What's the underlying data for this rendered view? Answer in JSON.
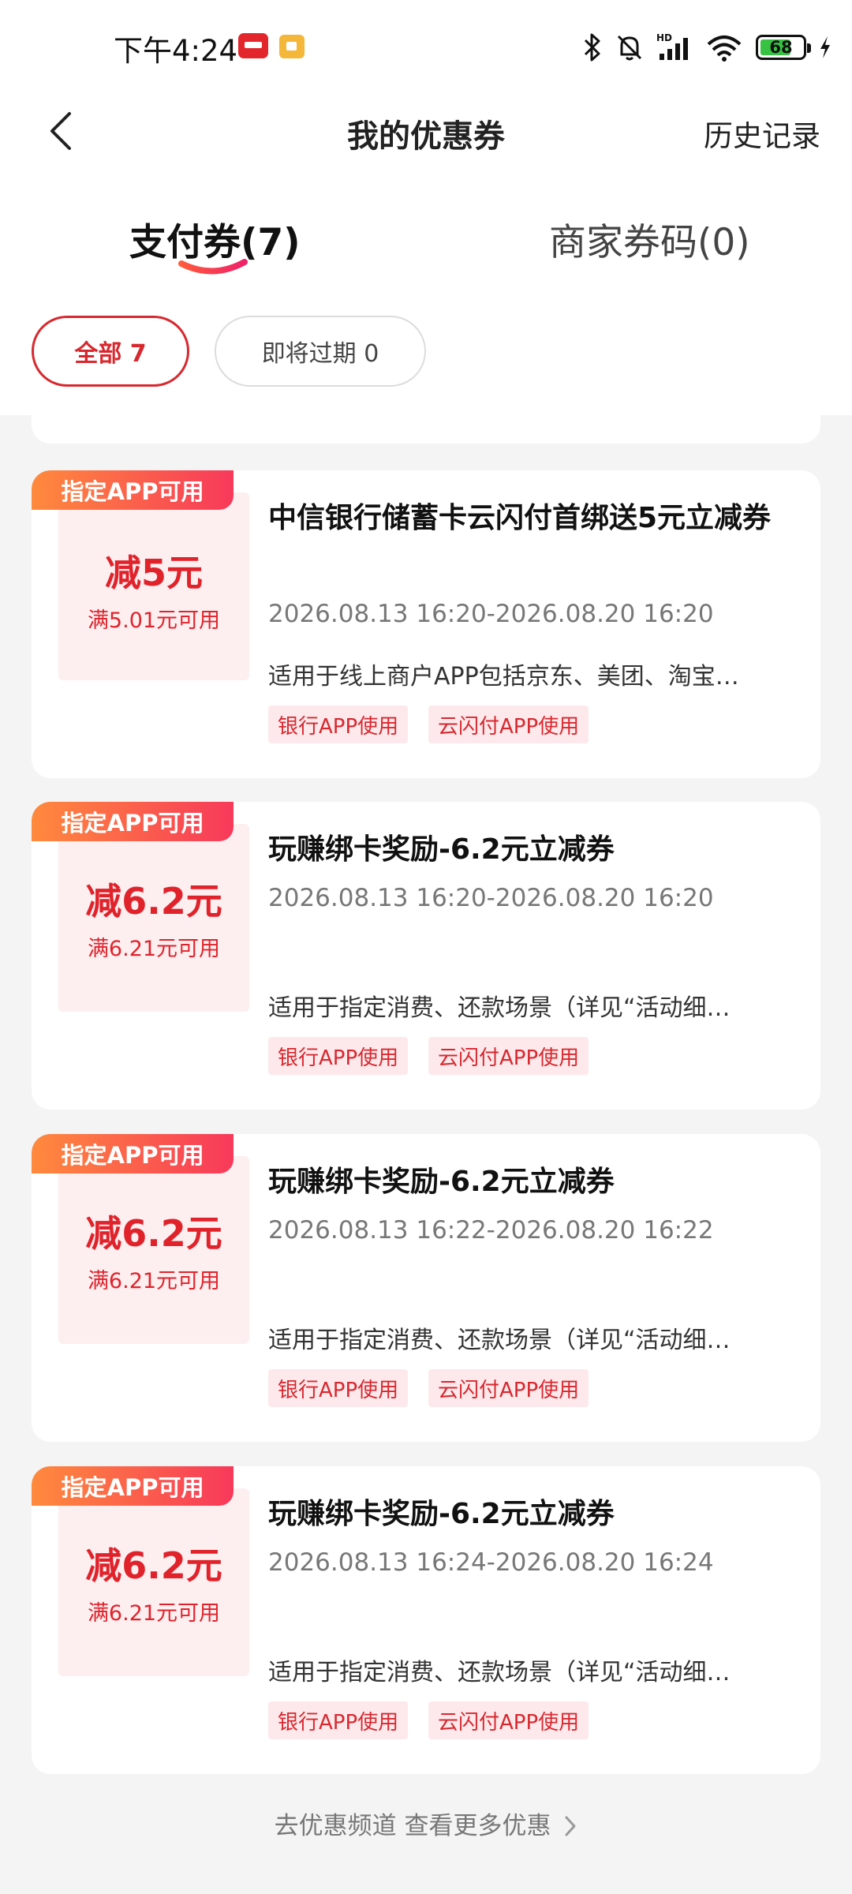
{
  "status_bar": {
    "time": "下午4:24",
    "battery_level": "68",
    "icons": [
      "bluetooth-icon",
      "mute-bell-icon",
      "hd-signal-icon",
      "wifi-icon",
      "battery-icon",
      "charging-icon"
    ]
  },
  "header": {
    "title": "我的优惠券",
    "history": "历史记录"
  },
  "tabs": [
    {
      "label": "支付券(7)",
      "active": true
    },
    {
      "label": "商家券码(0)",
      "active": false
    }
  ],
  "filters": [
    {
      "label": "全部 7",
      "active": true
    },
    {
      "label": "即将过期 0",
      "active": false
    }
  ],
  "coupons": [
    {
      "ribbon": "指定APP可用",
      "amount": "减5元",
      "condition": "满5.01元可用",
      "title": "中信银行储蓄卡云闪付首绑送5元立减券",
      "validity": "2026.08.13 16:20-2026.08.20 16:20",
      "description": "适用于线上商户APP包括京东、美团、淘宝…",
      "tags": [
        "银行APP使用",
        "云闪付APP使用"
      ]
    },
    {
      "ribbon": "指定APP可用",
      "amount": "减6.2元",
      "condition": "满6.21元可用",
      "title": "玩赚绑卡奖励-6.2元立减券",
      "validity": "2026.08.13 16:20-2026.08.20 16:20",
      "description": "适用于指定消费、还款场景（详见“活动细…",
      "tags": [
        "银行APP使用",
        "云闪付APP使用"
      ]
    },
    {
      "ribbon": "指定APP可用",
      "amount": "减6.2元",
      "condition": "满6.21元可用",
      "title": "玩赚绑卡奖励-6.2元立减券",
      "validity": "2026.08.13 16:22-2026.08.20 16:22",
      "description": "适用于指定消费、还款场景（详见“活动细…",
      "tags": [
        "银行APP使用",
        "云闪付APP使用"
      ]
    },
    {
      "ribbon": "指定APP可用",
      "amount": "减6.2元",
      "condition": "满6.21元可用",
      "title": "玩赚绑卡奖励-6.2元立减券",
      "validity": "2026.08.13 16:24-2026.08.20 16:24",
      "description": "适用于指定消费、还款场景（详见“活动细…",
      "tags": [
        "银行APP使用",
        "云闪付APP使用"
      ]
    }
  ],
  "footer": {
    "link": "去优惠频道 查看更多优惠"
  },
  "colors": {
    "accent": "#d8282f",
    "ribbon_start": "#ff8a3d",
    "ribbon_end": "#f7395a",
    "background": "#f4f4f4"
  }
}
